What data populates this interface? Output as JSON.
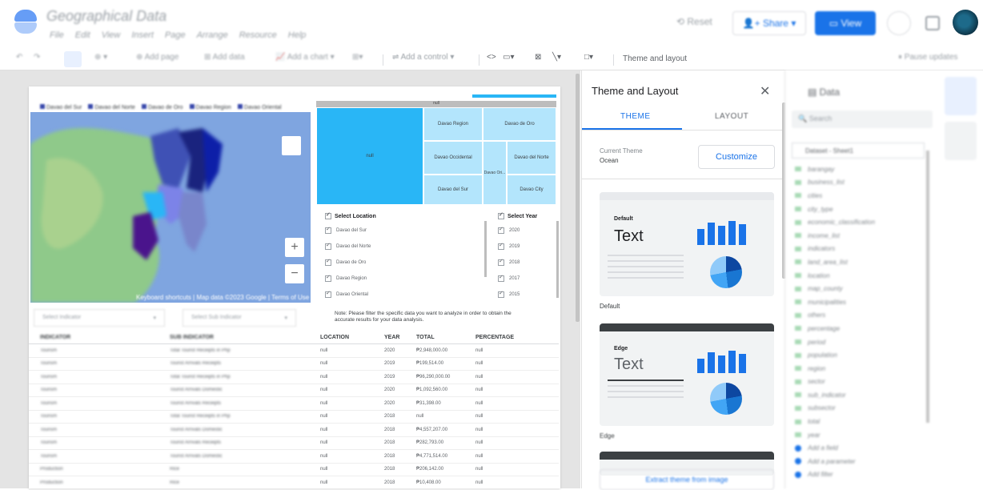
{
  "app": {
    "title": "Geographical Data"
  },
  "menu": [
    "File",
    "Edit",
    "View",
    "Insert",
    "Page",
    "Arrange",
    "Resource",
    "Help"
  ],
  "header": {
    "reset_label": "Reset",
    "share_label": "Share",
    "view_label": "View"
  },
  "toolbar": {
    "add_page": "Add page",
    "add_data": "Add data",
    "add_chart": "Add a chart",
    "add_control": "Add a control",
    "theme_layout": "Theme and layout",
    "pause_updates": "Pause updates"
  },
  "map": {
    "legend": [
      "Davao del Sur",
      "Davao del Norte",
      "Davao de Oro",
      "Davao Region",
      "Davao Oriental"
    ],
    "attribution": "Keyboard shortcuts | Map data ©2023 Google | Terms of Use"
  },
  "treemap": {
    "header": "null",
    "cells": [
      "null",
      "Davao Region",
      "Davao de Oro",
      "Davao Occidental",
      "Davao del Norte",
      "Davao Ori...",
      "Davao del Sur",
      "Davao City"
    ]
  },
  "filters": {
    "location": {
      "title": "Select Location",
      "items": [
        "Davao del Sur",
        "Davao del Norte",
        "Davao de Oro",
        "Davao Region",
        "Davao Oriental"
      ]
    },
    "year": {
      "title": "Select Year",
      "items": [
        "2020",
        "2019",
        "2018",
        "2017",
        "2015"
      ]
    }
  },
  "note": "Note: Please filter the specific data you want to analyze in order to obtain the accurate results for your data analysis.",
  "dropdowns": {
    "indicator": "Select Indicator",
    "sub_indicator": "Select Sub Indicator"
  },
  "table": {
    "headers": [
      "INDICATOR",
      "SUB INDICATOR",
      "LOCATION",
      "YEAR",
      "TOTAL",
      "PERCENTAGE"
    ],
    "rows": [
      [
        "Tourism",
        "Total Tourist Receipts in Php",
        "null",
        "2020",
        "₱2,948,000.00",
        "null"
      ],
      [
        "Tourism",
        "Tourist Arrivals Receipts",
        "null",
        "2019",
        "₱199,514.00",
        "null"
      ],
      [
        "Tourism",
        "Total Tourist Receipts in Php",
        "null",
        "2019",
        "₱96,290,000.00",
        "null"
      ],
      [
        "Tourism",
        "Tourist Arrivals Domestic",
        "null",
        "2020",
        "₱1,092,560.00",
        "null"
      ],
      [
        "Tourism",
        "Tourist Arrivals Receipts",
        "null",
        "2020",
        "₱31,398.00",
        "null"
      ],
      [
        "Tourism",
        "Total Tourist Receipts in Php",
        "null",
        "2018",
        "null",
        "null"
      ],
      [
        "Tourism",
        "Tourist Arrivals Domestic",
        "null",
        "2018",
        "₱4,557,207.00",
        "null"
      ],
      [
        "Tourism",
        "Tourist Arrivals Receipts",
        "null",
        "2018",
        "₱282,793.00",
        "null"
      ],
      [
        "Tourism",
        "Tourist Arrivals Domestic",
        "null",
        "2018",
        "₱4,771,514.00",
        "null"
      ],
      [
        "Production",
        "Rice",
        "null",
        "2018",
        "₱206,142.00",
        "null"
      ],
      [
        "Production",
        "Rice",
        "null",
        "2018",
        "₱10,408.00",
        "null"
      ]
    ]
  },
  "theme_panel": {
    "title": "Theme and Layout",
    "tab_theme": "THEME",
    "tab_layout": "LAYOUT",
    "current_theme_label": "Current Theme",
    "current_theme": "Ocean",
    "customize": "Customize",
    "cards": [
      {
        "small": "Default",
        "big": "Text",
        "label": "Default"
      },
      {
        "small": "Edge",
        "big": "Text",
        "label": "Edge"
      }
    ],
    "extract": "Extract theme from image"
  },
  "data_panel": {
    "title": "Data",
    "search_placeholder": "Search",
    "source": "Dataset - Sheet1",
    "fields": [
      "barangay",
      "business_list",
      "cities",
      "city_type",
      "economic_classification",
      "income_list",
      "indicators",
      "land_area_list",
      "location",
      "map_county",
      "municipalities",
      "others",
      "percentage",
      "period",
      "population",
      "region",
      "sector",
      "sub_indicator",
      "subsector",
      "total",
      "year",
      "Add a field",
      "Add a parameter",
      "Add filter"
    ]
  },
  "colors": {
    "accent": "#1a73e8",
    "map_water": "#7fa5e0",
    "treemap_main": "#29b6f6",
    "treemap_light": "#b3e5fc"
  }
}
